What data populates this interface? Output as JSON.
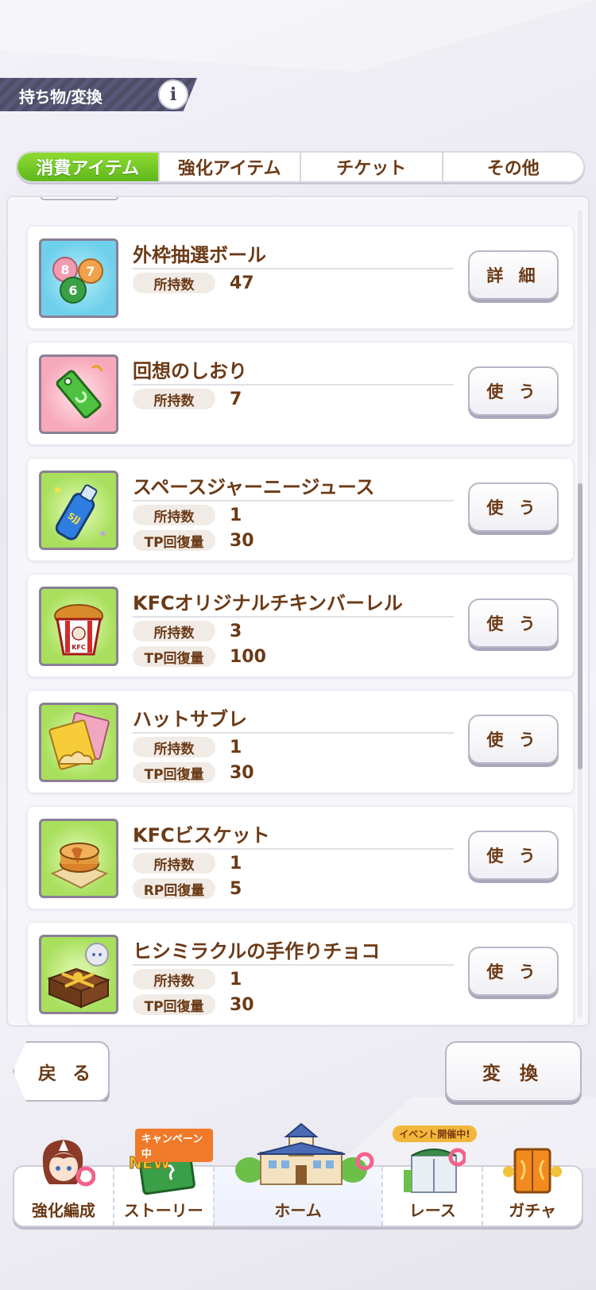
{
  "header": {
    "title": "持ち物/変換",
    "info_icon": "info-icon"
  },
  "tabs": [
    {
      "label": "消費アイテム",
      "active": true
    },
    {
      "label": "強化アイテム",
      "active": false
    },
    {
      "label": "チケット",
      "active": false
    },
    {
      "label": "その他",
      "active": false
    }
  ],
  "items": [
    {
      "name": "外枠抽選ボール",
      "icon": "lottery-balls-icon",
      "stats": [
        {
          "label": "所持数",
          "value": "47"
        }
      ],
      "action": "詳 細"
    },
    {
      "name": "回想のしおり",
      "icon": "bookmark-icon",
      "stats": [
        {
          "label": "所持数",
          "value": "7"
        }
      ],
      "action": "使 う"
    },
    {
      "name": "スペースジャーニージュース",
      "icon": "juice-bottle-icon",
      "stats": [
        {
          "label": "所持数",
          "value": "1"
        },
        {
          "label": "TP回復量",
          "value": "30"
        }
      ],
      "action": "使 う"
    },
    {
      "name": "KFCオリジナルチキンバーレル",
      "icon": "chicken-bucket-icon",
      "stats": [
        {
          "label": "所持数",
          "value": "3"
        },
        {
          "label": "TP回復量",
          "value": "100"
        }
      ],
      "action": "使 う"
    },
    {
      "name": "ハットサブレ",
      "icon": "cookie-pack-icon",
      "stats": [
        {
          "label": "所持数",
          "value": "1"
        },
        {
          "label": "TP回復量",
          "value": "30"
        }
      ],
      "action": "使 う"
    },
    {
      "name": "KFCビスケット",
      "icon": "biscuit-icon",
      "stats": [
        {
          "label": "所持数",
          "value": "1"
        },
        {
          "label": "RP回復量",
          "value": "5"
        }
      ],
      "action": "使 う"
    },
    {
      "name": "ヒシミラクルの手作りチョコ",
      "icon": "chocolate-box-icon",
      "stats": [
        {
          "label": "所持数",
          "value": "1"
        },
        {
          "label": "TP回復量",
          "value": "30"
        }
      ],
      "action": "使 う"
    }
  ],
  "buttons": {
    "back": "戻 る",
    "convert": "変 換"
  },
  "bottom_nav": [
    {
      "label": "強化編成",
      "icon": "character-icon"
    },
    {
      "label": "ストーリー",
      "icon": "story-book-icon",
      "badge": "キャンペーン中",
      "badge2": "NEW"
    },
    {
      "label": "ホーム",
      "icon": "school-building-icon"
    },
    {
      "label": "レース",
      "icon": "race-gate-icon",
      "badge": "イベント開催中!"
    },
    {
      "label": "ガチャ",
      "icon": "gacha-door-icon"
    }
  ],
  "colors": {
    "tab_active": "#6fc423",
    "text_brown": "#6b3a16",
    "header_band": "#52526f"
  }
}
